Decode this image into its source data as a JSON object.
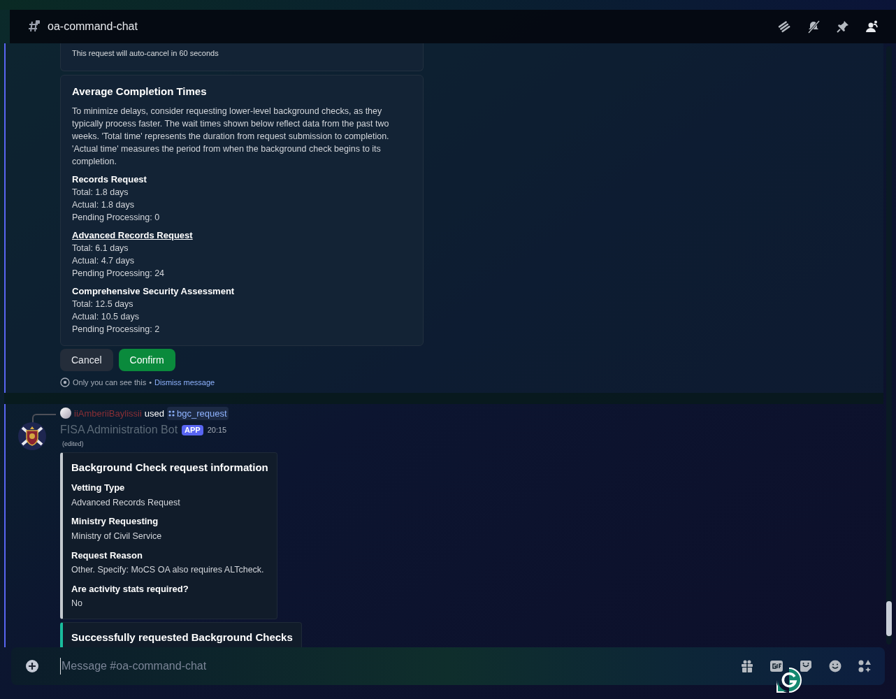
{
  "channel": {
    "name": "oa-command-chat"
  },
  "messages": [
    {
      "kind": "ephemeral",
      "notice": "This request will auto-cancel in 60 seconds",
      "embed": {
        "title": "Average Completion Times",
        "description": "To minimize delays, consider requesting lower-level background checks, as they typically process faster. The wait times shown below reflect data from the past two weeks. 'Total time' represents the duration from request submission to completion. 'Actual time' measures the period from when the background check begins to its completion.",
        "fields": [
          {
            "name": "Records Request",
            "underlined": false,
            "lines": [
              "Total: 1.8 days",
              "Actual: 1.8 days",
              "Pending Processing: 0"
            ]
          },
          {
            "name": "Advanced Records Request",
            "underlined": true,
            "lines": [
              "Total: 6.1 days",
              "Actual: 4.7 days",
              "Pending Processing: 24"
            ]
          },
          {
            "name": "Comprehensive Security Assessment",
            "underlined": false,
            "lines": [
              "Total: 12.5 days",
              "Actual: 10.5 days",
              "Pending Processing: 2"
            ]
          }
        ]
      },
      "buttons": [
        {
          "label": "Cancel",
          "kind": "secondary"
        },
        {
          "label": "Confirm",
          "kind": "success"
        }
      ],
      "footer": {
        "text": "Only you can see this",
        "separator": "•",
        "link": "Dismiss message"
      }
    },
    {
      "kind": "bot",
      "reply": {
        "user": "iiAmberiiBaylissii",
        "verb": "used",
        "command": "bgc_request"
      },
      "author": "FISA Administration Bot",
      "badge": "APP",
      "time": "20:15",
      "edited": "(edited)",
      "embeds": [
        {
          "title": "Background Check request information",
          "color": "#c4c9ce",
          "fields": [
            {
              "name": "Vetting Type",
              "value": "Advanced Records Request"
            },
            {
              "name": "Ministry Requesting",
              "value": "Ministry of Civil Service"
            },
            {
              "name": "Request Reason",
              "value": "Other. Specify: MoCS OA also requires ALTcheck."
            },
            {
              "name": "Are activity stats required?",
              "value": "No"
            }
          ]
        },
        {
          "title": "Successfully requested Background Checks",
          "color": "#1abc9c"
        }
      ]
    }
  ],
  "composer": {
    "placeholder": "Message #oa-command-chat"
  }
}
